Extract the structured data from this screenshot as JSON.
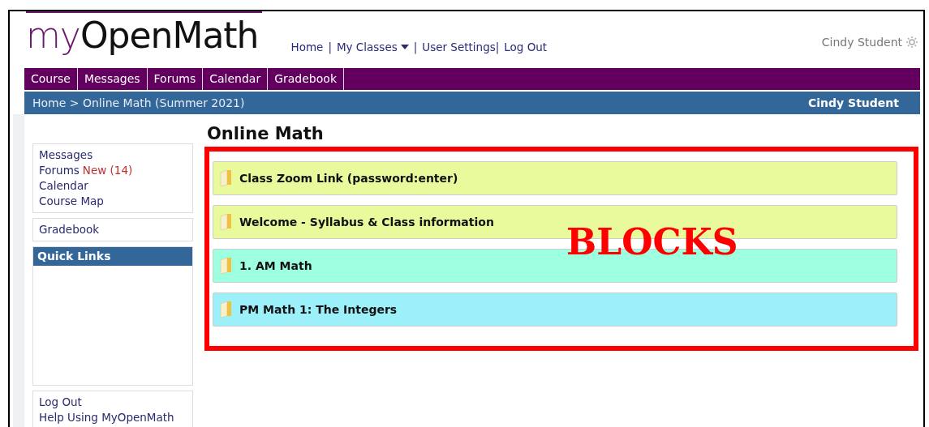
{
  "logo": {
    "prefix": "my",
    "name": "OpenMath"
  },
  "top_links": [
    "Home",
    "|",
    "My Classes",
    "|",
    "User Settings|",
    "Log Out"
  ],
  "user": "Cindy Student",
  "tabs": [
    {
      "label": "Course"
    },
    {
      "label": "Messages"
    },
    {
      "label": "Forums"
    },
    {
      "label": "Calendar"
    },
    {
      "label": "Gradebook"
    }
  ],
  "breadcrumb": {
    "path": "Home > Online Math (Summer 2021)",
    "user": "Cindy Student"
  },
  "sidebar": {
    "links": [
      {
        "label": "Messages"
      },
      {
        "label": "Forums",
        "badge": "New (14)"
      },
      {
        "label": "Calendar"
      },
      {
        "label": "Course Map"
      }
    ],
    "gradebook": "Gradebook",
    "quick_links": "Quick Links",
    "bottom_links": [
      "Log Out",
      "Help Using MyOpenMath"
    ]
  },
  "page_title": "Online Math",
  "annotation": "BLOCKS",
  "blocks": [
    {
      "title": "Class Zoom Link (password:enter)",
      "color": "#e8fa9c"
    },
    {
      "title": "Welcome - Syllabus & Class information",
      "color": "#e8fa9c"
    },
    {
      "title": "1. AM Math",
      "color": "#9effe0"
    },
    {
      "title": "PM Math 1: The Integers",
      "color": "#9cf0fa"
    }
  ]
}
